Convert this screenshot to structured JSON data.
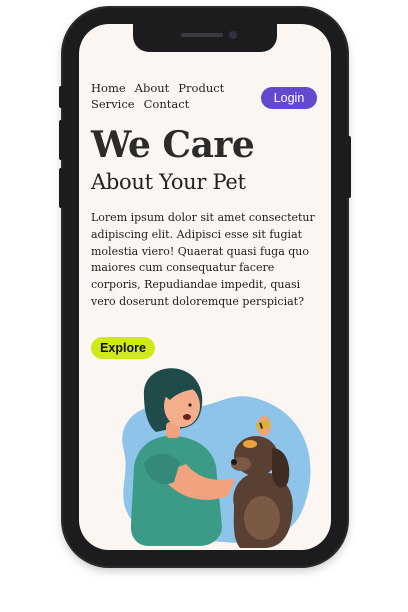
{
  "nav": {
    "items": [
      "Home",
      "About",
      "Product",
      "Service",
      "Contact"
    ]
  },
  "login_label": "Login",
  "hero": {
    "title": "We Care",
    "subtitle": "About Your Pet",
    "paragraph": "Lorem ipsum dolor sit amet consectetur adipiscing elit. Adipisci esse sit fugiat molestia viero! Quaerat quasi fuga quo maiores cum consequatur facere corporis, Repudiandae impedit, quasi vero doserunt doloremque perspiciat?",
    "explore_label": "Explore"
  },
  "colors": {
    "login_bg": "#6448cf",
    "explore_bg": "#cfe81a",
    "screen_bg": "#fbf6f1"
  },
  "icons": {
    "illustration": "woman-grooming-dog-illustration"
  }
}
